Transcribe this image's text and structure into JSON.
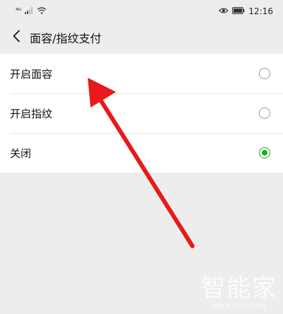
{
  "status_bar": {
    "carrier_mark": "⁴ᴳ",
    "time": "12:16",
    "icons": [
      "signal-icon",
      "wifi-icon",
      "eye-icon",
      "battery-icon"
    ]
  },
  "nav": {
    "back_icon": "chevron-left-icon",
    "title": "面容/指纹支付"
  },
  "options": [
    {
      "label": "开启面容",
      "selected": false
    },
    {
      "label": "开启指纹",
      "selected": false
    },
    {
      "label": "关闭",
      "selected": true
    }
  ],
  "annotation": {
    "arrow_color": "#e8191a"
  },
  "watermark": {
    "logo": "智能家",
    "url": "www.znj.com"
  },
  "colors": {
    "accent": "#1aad19",
    "background": "#ededed"
  }
}
